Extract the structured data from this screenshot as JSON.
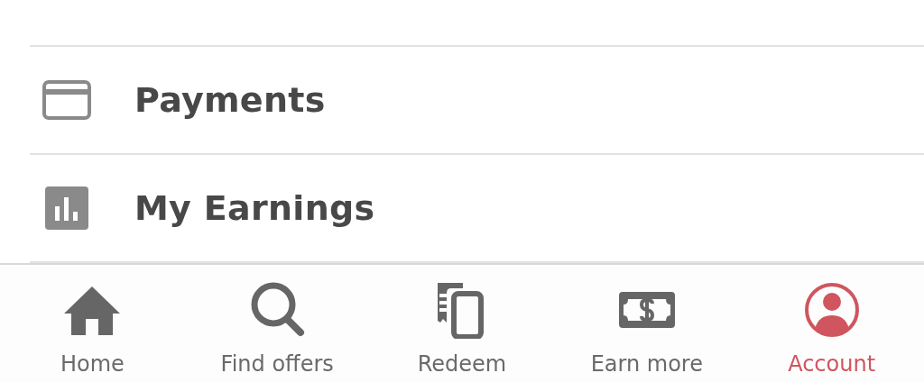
{
  "menu": [
    {
      "label": "Payments"
    },
    {
      "label": "My Earnings"
    }
  ],
  "tab_bar": [
    {
      "label": "Home",
      "selected": false
    },
    {
      "label": "Find offers",
      "selected": false
    },
    {
      "label": "Redeem",
      "selected": false
    },
    {
      "label": "Earn more",
      "selected": false
    },
    {
      "label": "Account",
      "selected": true
    }
  ]
}
